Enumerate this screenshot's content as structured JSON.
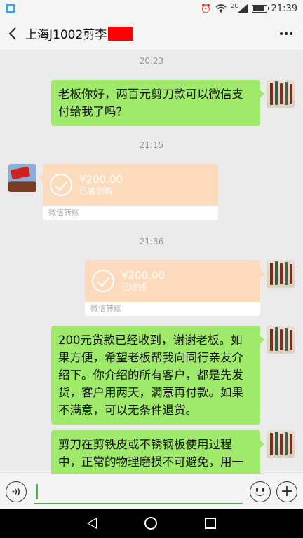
{
  "status_bar": {
    "time": "21:39",
    "network": "2G",
    "icons": [
      "app-notification-icon",
      "alarm-icon",
      "wifi-icon",
      "signal-icon",
      "battery-icon"
    ]
  },
  "header": {
    "title": "上海J1002剪李",
    "back_icon": "chevron-left-icon",
    "more_icon": "more-icon"
  },
  "chat": {
    "timestamps": [
      "20:23",
      "21:15",
      "21:36"
    ],
    "messages": [
      {
        "sender": "me",
        "type": "text",
        "text": "老板你好，两百元剪刀款可以微信支付给我了吗?"
      },
      {
        "sender": "other",
        "type": "transfer",
        "amount": "¥200.00",
        "status": "已被领取",
        "footer": "微信转账"
      },
      {
        "sender": "me",
        "type": "transfer",
        "amount": "¥200.00",
        "status": "已收钱",
        "footer": "微信转账"
      },
      {
        "sender": "me",
        "type": "text",
        "text": "200元货款已经收到，谢谢老板。如果方便，希望老板帮我向同行亲友介绍下。你介绍的所有客户，都是先发货，客户用两天，满意再付款。如果不满意，可以无条件退货。"
      },
      {
        "sender": "me",
        "type": "text",
        "text": "剪刀在剪铁皮或不锈钢板使用过程中，正常的物理磨损不可避免，用一年半载"
      }
    ]
  },
  "input_bar": {
    "voice_icon": "voice-icon",
    "emoji_icon": "emoji-icon",
    "plus_icon": "plus-icon",
    "value": ""
  },
  "nav_bar": {
    "icons": [
      "back-triangle-icon",
      "home-circle-icon",
      "recent-square-icon"
    ]
  },
  "colors": {
    "bubble_green": "#9fe96b",
    "transfer_orange": "#fbdbbb",
    "redaction": "#ff0000",
    "chat_bg": "#ebebeb"
  }
}
